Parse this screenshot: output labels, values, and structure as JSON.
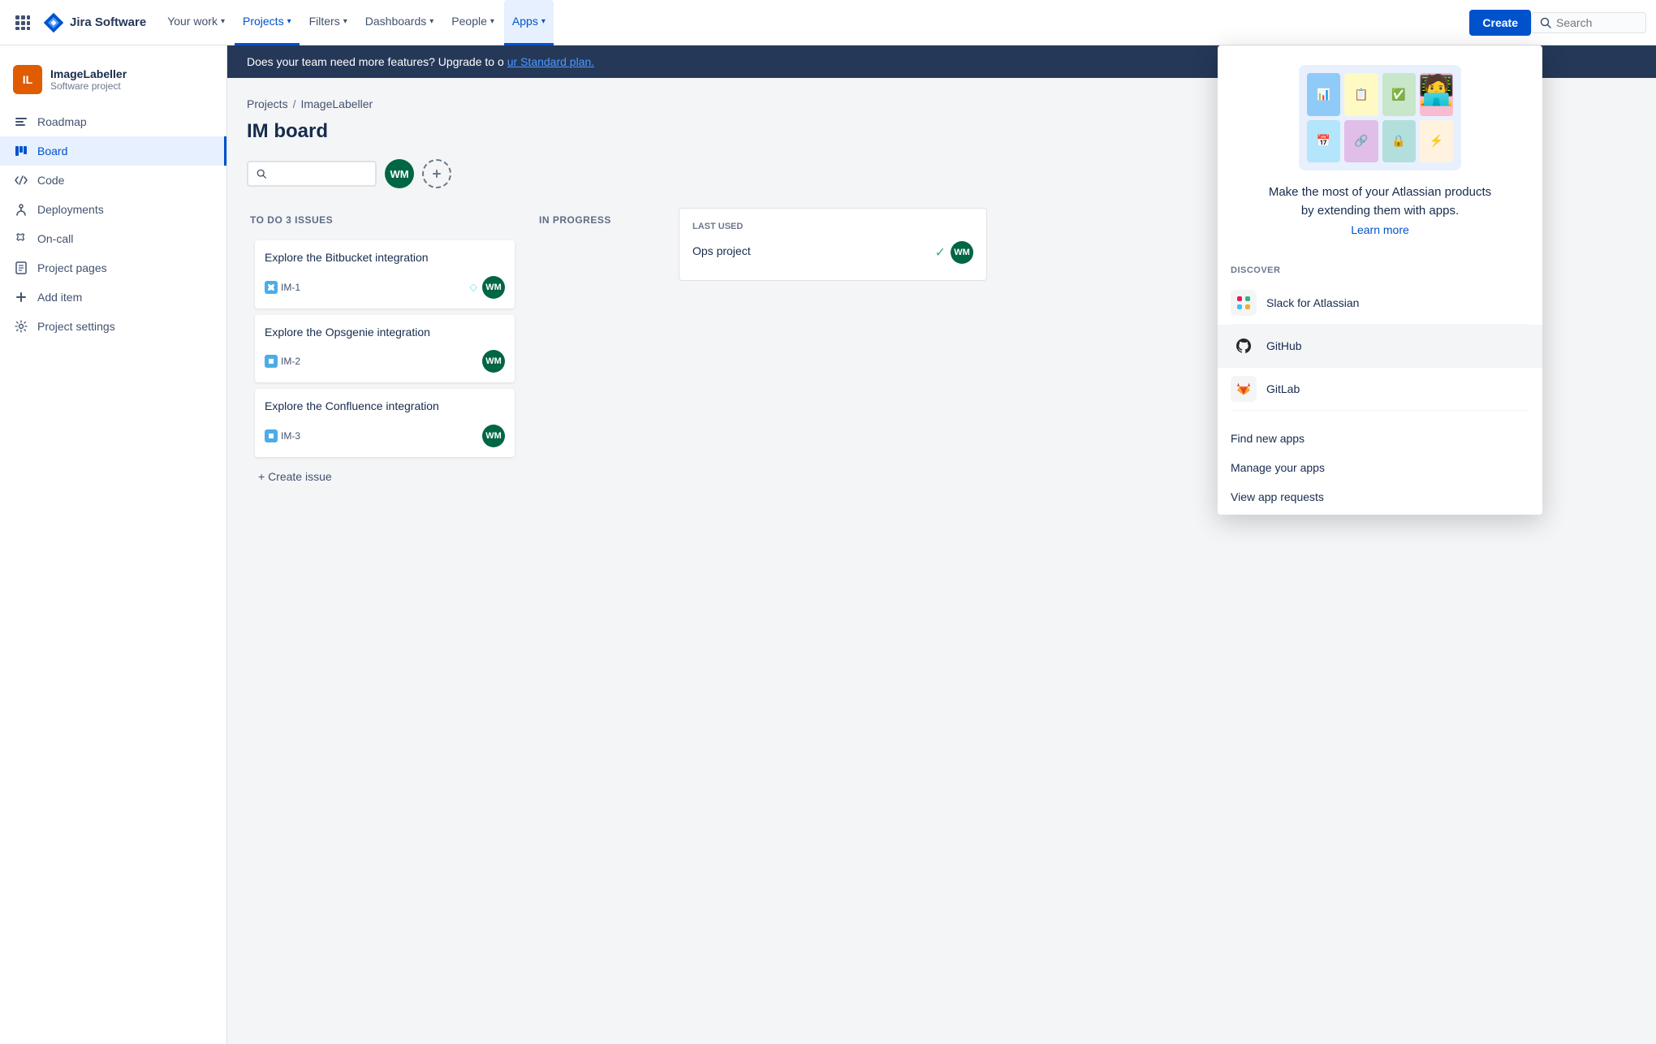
{
  "topnav": {
    "logo_text": "Jira Software",
    "nav_items": [
      {
        "id": "your-work",
        "label": "Your work",
        "active": false
      },
      {
        "id": "projects",
        "label": "Projects",
        "active": true
      },
      {
        "id": "filters",
        "label": "Filters",
        "active": false
      },
      {
        "id": "dashboards",
        "label": "Dashboards",
        "active": false
      },
      {
        "id": "people",
        "label": "People",
        "active": false
      },
      {
        "id": "apps",
        "label": "Apps",
        "active": true,
        "apps_open": true
      }
    ],
    "create_label": "Create",
    "search_placeholder": "Search"
  },
  "sidebar": {
    "project_name": "ImageLabeller",
    "project_type": "Software project",
    "items": [
      {
        "id": "roadmap",
        "label": "Roadmap",
        "icon": "roadmap"
      },
      {
        "id": "board",
        "label": "Board",
        "icon": "board",
        "active": true
      },
      {
        "id": "code",
        "label": "Code",
        "icon": "code"
      },
      {
        "id": "deployments",
        "label": "Deployments",
        "icon": "deployments"
      },
      {
        "id": "on-call",
        "label": "On-call",
        "icon": "on-call"
      },
      {
        "id": "project-pages",
        "label": "Project pages",
        "icon": "pages"
      },
      {
        "id": "add-item",
        "label": "Add item",
        "icon": "add"
      },
      {
        "id": "project-settings",
        "label": "Project settings",
        "icon": "settings"
      }
    ]
  },
  "banner": {
    "text": "Does your team need more features?",
    "link_text": "ur Standard plan.",
    "full_text": "Does your team need more features? Upgrade to ou"
  },
  "board": {
    "breadcrumb": [
      "Projects",
      "ImageLabeller"
    ],
    "title": "IM board",
    "columns": [
      {
        "id": "todo",
        "header": "TO DO 3 ISSUES",
        "cards": [
          {
            "id": "im1",
            "title": "Explore the Bitbucket integration",
            "issue_id": "IM-1",
            "has_story_icon": true,
            "assignee_color": "#006644"
          },
          {
            "id": "im2",
            "title": "Explore the Opsgenie integration",
            "issue_id": "IM-2",
            "has_story_icon": false,
            "assignee_color": "#006644"
          },
          {
            "id": "im3",
            "title": "Explore the Confluence integration",
            "issue_id": "IM-3",
            "has_story_icon": false,
            "assignee_color": "#006644"
          }
        ],
        "create_issue_label": "+ Create issue"
      },
      {
        "id": "inprogress",
        "header": "IN PROGRESS",
        "cards": []
      }
    ]
  },
  "right_panel": {
    "header": "LAST USED",
    "title": "Ops project",
    "assignee_color": "#006644",
    "check_color": "#36b37e"
  },
  "apps_dropdown": {
    "hero_text": "Make the most of your Atlassian products\nby extending them with apps.",
    "learn_more_label": "Learn more",
    "discover_label": "DISCOVER",
    "discover_items": [
      {
        "id": "slack",
        "name": "Slack for Atlassian",
        "icon": "slack"
      },
      {
        "id": "github",
        "name": "GitHub",
        "icon": "github"
      },
      {
        "id": "gitlab",
        "name": "GitLab",
        "icon": "gitlab"
      }
    ],
    "action_items": [
      {
        "id": "find-apps",
        "label": "Find new apps"
      },
      {
        "id": "manage-apps",
        "label": "Manage your apps"
      },
      {
        "id": "app-requests",
        "label": "View app requests"
      }
    ],
    "hero_tiles": [
      {
        "color": "#e3f2fd"
      },
      {
        "color": "#fff3e0"
      },
      {
        "color": "#e8f5e9"
      },
      {
        "color": "#fce4ec"
      },
      {
        "color": "#e1f5fe"
      },
      {
        "color": "#f3e5f5"
      },
      {
        "color": "#e0f2f1"
      },
      {
        "color": "#fff8e1"
      },
      {
        "color": "#e8eaf6"
      },
      {
        "color": "#fbe9e7"
      },
      {
        "color": "#e0f7fa"
      },
      {
        "color": "#f9fbe7"
      }
    ]
  }
}
